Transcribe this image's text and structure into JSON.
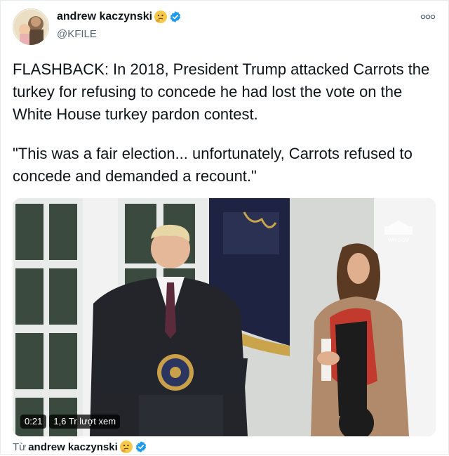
{
  "author": {
    "name": "andrew kaczynski",
    "handle": "@KFILE",
    "emoji_icon": "thinking-face-emoji",
    "verified_icon": "verified-badge-icon",
    "verified_color": "#1d9bf0"
  },
  "more_icon": "more-options-icon",
  "tweet": {
    "paragraph_1": "FLASHBACK: In 2018, President Trump attacked Carrots the turkey for refusing to concede he had lost the vote on the White House turkey pardon contest.",
    "paragraph_2": "\"This was a fair election... unfortunately, Carrots refused to concede and demanded a recount.\""
  },
  "media": {
    "type": "video",
    "duration": "0:21",
    "views": "1,6 Tr lượt xem",
    "watermark": "WH.GOV"
  },
  "footer": {
    "from_prefix": "Từ",
    "from_name": "andrew kaczynski"
  }
}
